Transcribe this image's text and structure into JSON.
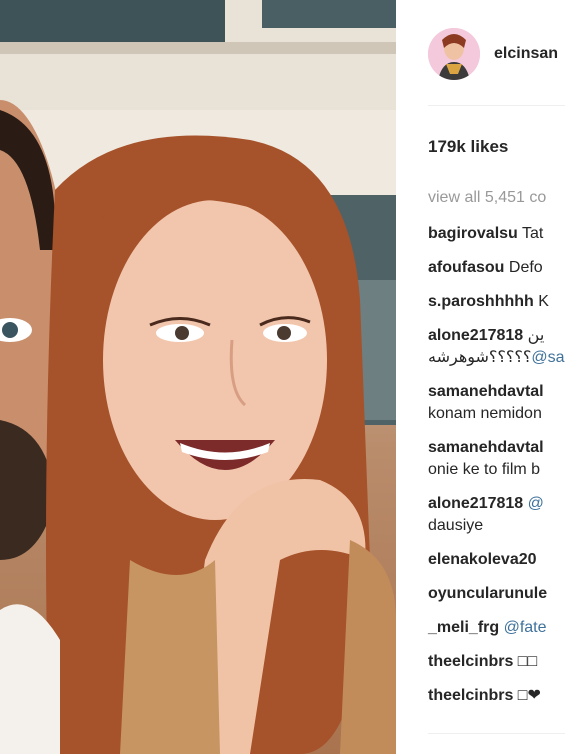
{
  "post": {
    "username": "elcinsan",
    "likes": "179k likes",
    "view_all": "view all 5,451 co",
    "comments": [
      {
        "user": "bagirovalsu",
        "text": " Tat"
      },
      {
        "user": "afoufasou",
        "text": " Defo"
      },
      {
        "user": "s.paroshhhhh",
        "text": " K"
      },
      {
        "user": "alone217818",
        "text": " ين",
        "line2_text": "؟؟؟؟؟شوهرشه",
        "line2_mention": "@san"
      },
      {
        "user": "samanehdavtal",
        "text": "",
        "line2_text": "konam nemidon"
      },
      {
        "user": "samanehdavtal",
        "text": "",
        "line2_text": "onie ke to film b"
      },
      {
        "user": "alone217818",
        "text": " ",
        "mention": "@",
        "line2_text": "dausiye"
      },
      {
        "user": "elenakoleva20",
        "text": ""
      },
      {
        "user": "oyuncularunule",
        "text": ""
      },
      {
        "user": "_meli_frg",
        "text": " ",
        "mention": "@fate"
      },
      {
        "user": "theelcinbrs",
        "text": " □□"
      },
      {
        "user": "theelcinbrs",
        "text": " □❤"
      }
    ]
  }
}
